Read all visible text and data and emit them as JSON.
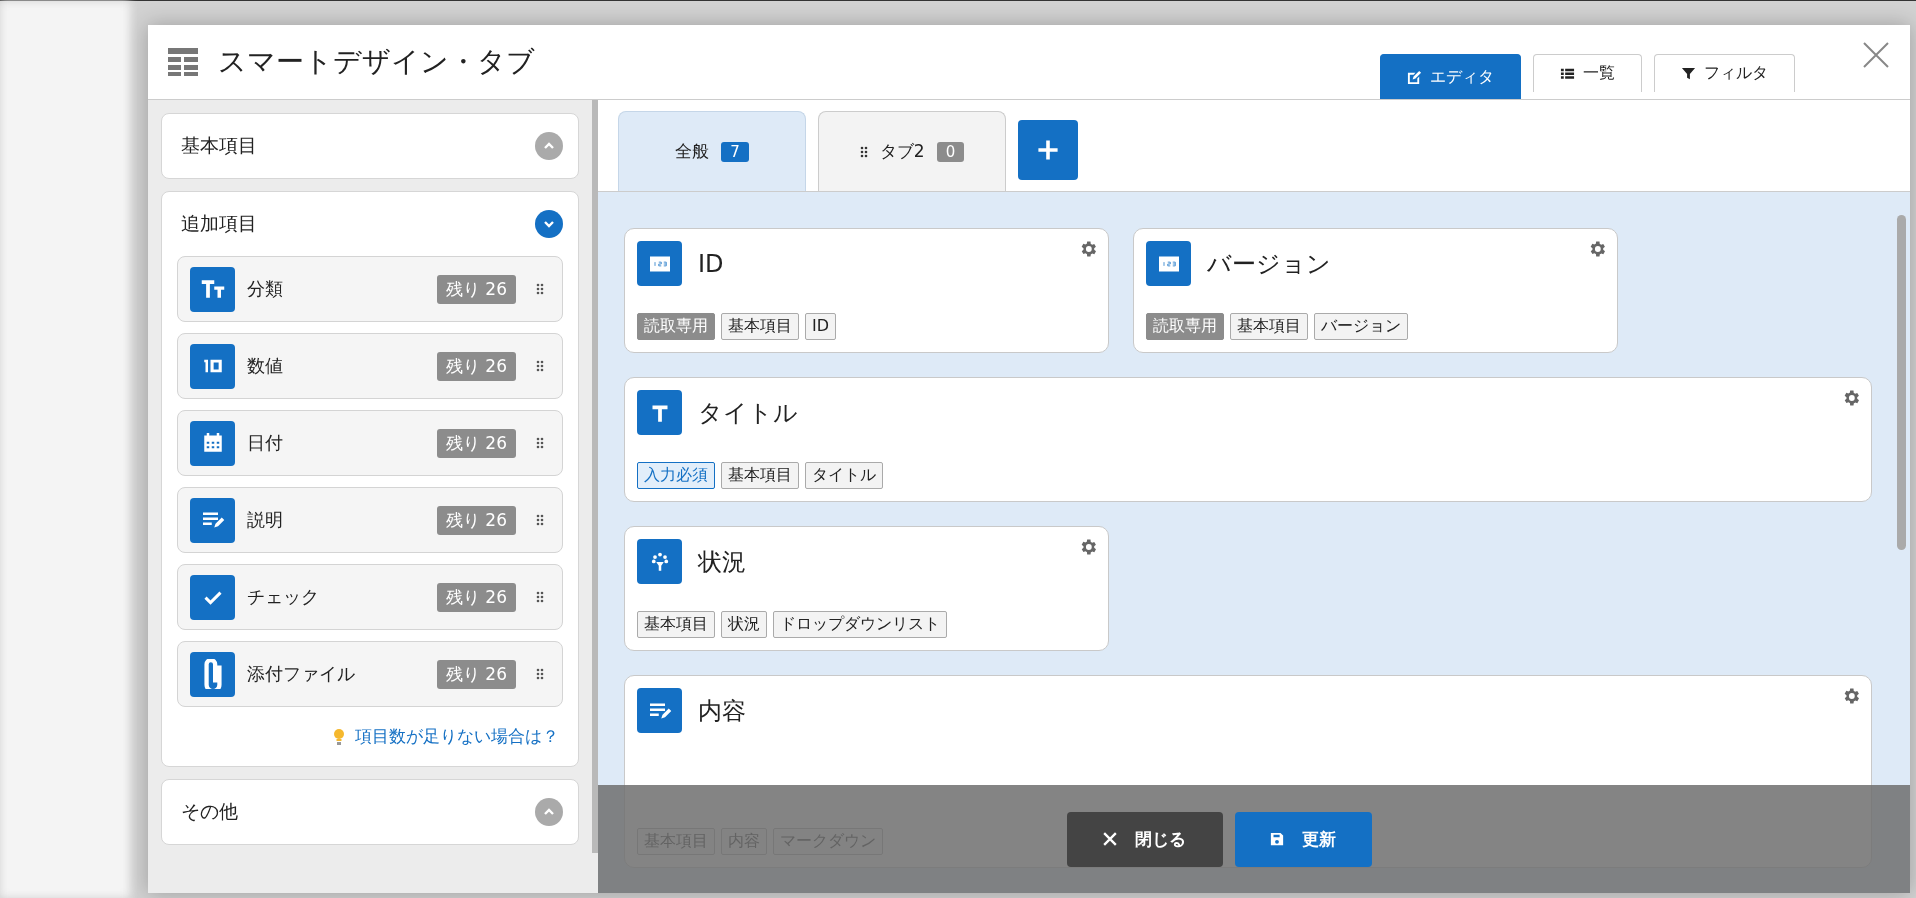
{
  "window": {
    "title": "スマートデザイン・タブ"
  },
  "view_buttons": [
    {
      "label": "エディタ",
      "kind": "edit",
      "selected": true
    },
    {
      "label": "一覧",
      "kind": "list",
      "selected": false
    },
    {
      "label": "フィルタ",
      "kind": "filter",
      "selected": false
    }
  ],
  "sidebar": {
    "sections": [
      {
        "title": "基本項目",
        "expanded": false
      },
      {
        "title": "追加項目",
        "expanded": true,
        "items": [
          {
            "label": "分類",
            "kind": "text-size",
            "remaining": "残り 26"
          },
          {
            "label": "数値",
            "kind": "number",
            "remaining": "残り 26"
          },
          {
            "label": "日付",
            "kind": "calendar",
            "remaining": "残り 26"
          },
          {
            "label": "説明",
            "kind": "description",
            "remaining": "残り 26"
          },
          {
            "label": "チェック",
            "kind": "check",
            "remaining": "残り 26"
          },
          {
            "label": "添付ファイル",
            "kind": "paperclip",
            "remaining": "残り 26"
          }
        ],
        "hint": "項目数が足りない場合は？"
      },
      {
        "title": "その他",
        "expanded": false
      }
    ]
  },
  "tabs": [
    {
      "label": "全般",
      "count": "7",
      "selected": true,
      "draggable": false
    },
    {
      "label": "タブ2",
      "count": "0",
      "selected": false,
      "draggable": true
    }
  ],
  "fields": [
    {
      "name": "ID",
      "kind": "number",
      "wide": false,
      "tall": false,
      "tags": [
        {
          "label": "読取専用",
          "kind": "readonly"
        },
        {
          "label": "基本項目",
          "kind": "normal"
        },
        {
          "label": "ID",
          "kind": "normal"
        }
      ]
    },
    {
      "name": "バージョン",
      "kind": "number",
      "wide": false,
      "tall": false,
      "tags": [
        {
          "label": "読取専用",
          "kind": "readonly"
        },
        {
          "label": "基本項目",
          "kind": "normal"
        },
        {
          "label": "バージョン",
          "kind": "normal"
        }
      ]
    },
    {
      "name": "タイトル",
      "kind": "title",
      "wide": true,
      "tall": false,
      "tags": [
        {
          "label": "入力必須",
          "kind": "required"
        },
        {
          "label": "基本項目",
          "kind": "normal"
        },
        {
          "label": "タイトル",
          "kind": "normal"
        }
      ]
    },
    {
      "name": "状況",
      "kind": "dropdown",
      "wide": false,
      "tall": false,
      "tags": [
        {
          "label": "基本項目",
          "kind": "normal"
        },
        {
          "label": "状況",
          "kind": "normal"
        },
        {
          "label": "ドロップダウンリスト",
          "kind": "normal"
        }
      ]
    },
    {
      "name": "内容",
      "kind": "markdown",
      "wide": true,
      "tall": true,
      "tags": [
        {
          "label": "基本項目",
          "kind": "normal"
        },
        {
          "label": "内容",
          "kind": "normal"
        },
        {
          "label": "マークダウン",
          "kind": "normal"
        }
      ]
    }
  ],
  "footer_buttons": [
    {
      "label": "閉じる",
      "kind": "close"
    },
    {
      "label": "更新",
      "kind": "save"
    }
  ]
}
